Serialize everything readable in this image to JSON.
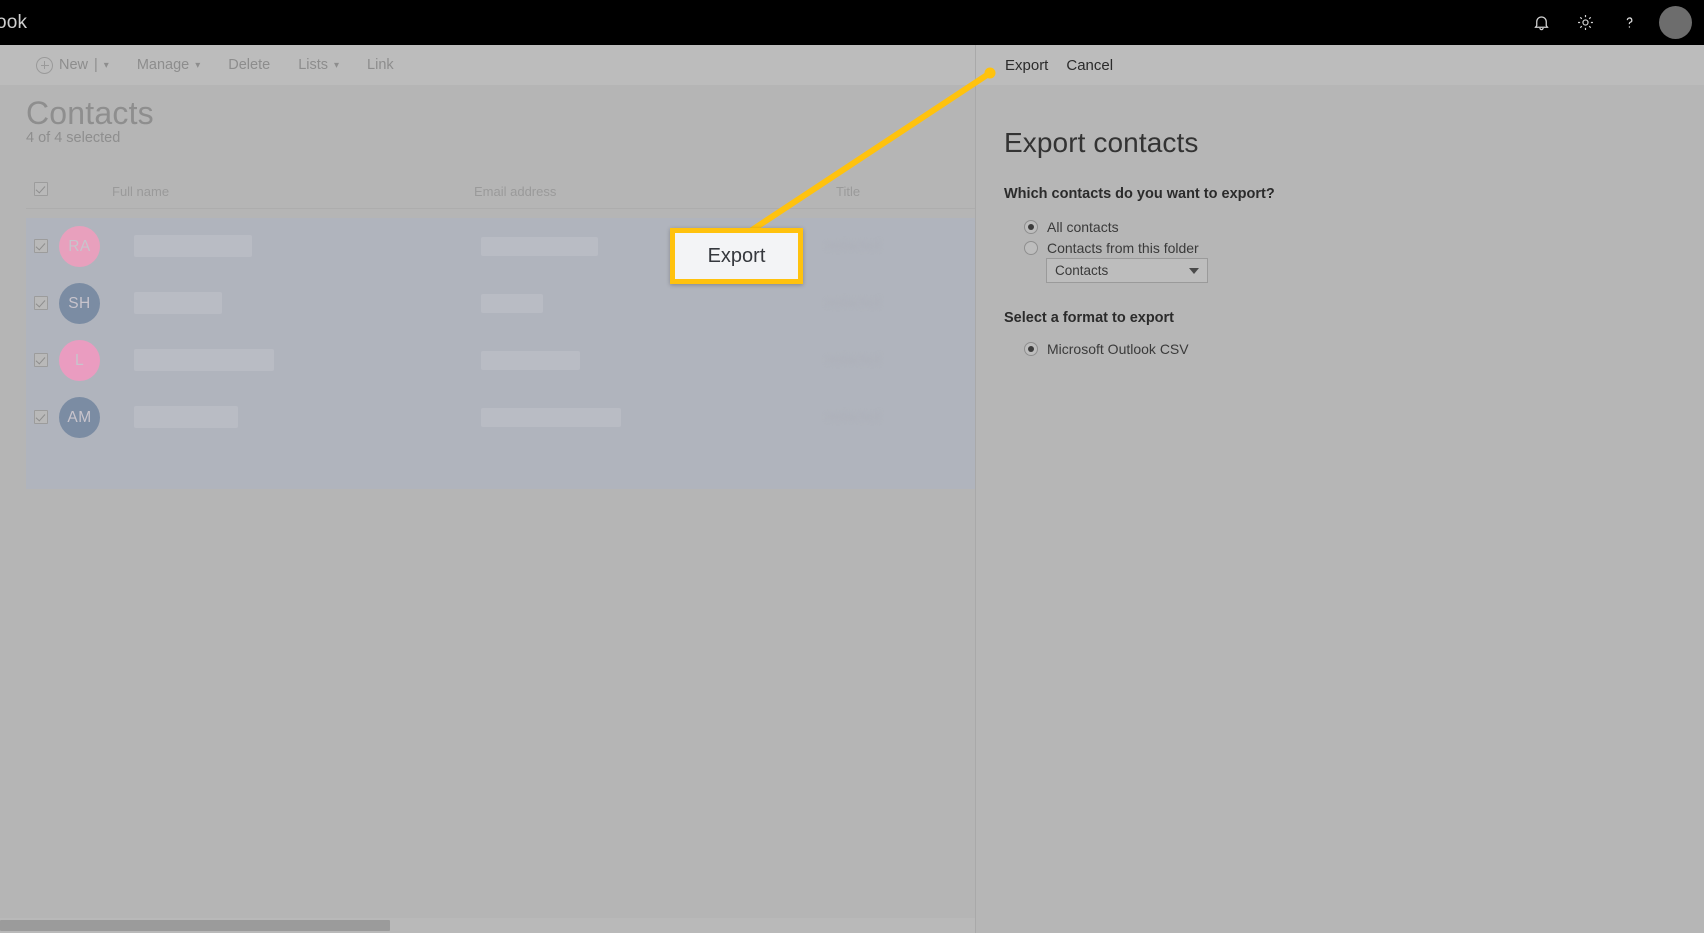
{
  "topbar": {
    "brand": "ook",
    "icons": [
      {
        "name": "notifications-icon",
        "glyph": "bell"
      },
      {
        "name": "settings-gear-icon",
        "glyph": "gear"
      },
      {
        "name": "help-icon",
        "glyph": "question"
      }
    ],
    "avatar_label": ""
  },
  "commandbar": {
    "items": [
      {
        "label": "New",
        "has_plus": true,
        "has_chevron": true,
        "separator": "|"
      },
      {
        "label": "Manage",
        "has_plus": false,
        "has_chevron": true
      },
      {
        "label": "Delete",
        "has_plus": false,
        "has_chevron": false
      },
      {
        "label": "Lists",
        "has_plus": false,
        "has_chevron": true
      },
      {
        "label": "Link",
        "has_plus": false,
        "has_chevron": false
      }
    ]
  },
  "page": {
    "title": "Contacts",
    "subtitle": "4 of 4 selected"
  },
  "table": {
    "columns": [
      "Full name",
      "Email address",
      "Title"
    ],
    "select_all_checked": true,
    "rows": [
      {
        "initials": "RA",
        "avatar_color": "#e8a0bd",
        "checked": true,
        "title_text": "redacted"
      },
      {
        "initials": "SH",
        "avatar_color": "#7b8ca3",
        "checked": true,
        "title_text": "redacted"
      },
      {
        "initials": "L",
        "avatar_color": "#ea9cc0",
        "checked": true,
        "title_text": "redacted"
      },
      {
        "initials": "AM",
        "avatar_color": "#7b8ca3",
        "checked": true,
        "title_text": "redacted"
      }
    ]
  },
  "export_panel": {
    "actions": {
      "export_label": "Export",
      "cancel_label": "Cancel"
    },
    "title": "Export contacts",
    "which_label": "Which contacts do you want to export?",
    "options": [
      {
        "label": "All contacts",
        "selected": true
      },
      {
        "label": "Contacts from this folder",
        "selected": false
      }
    ],
    "folder_dropdown": {
      "value": "Contacts"
    },
    "format_label": "Select a format to export",
    "formats": [
      {
        "label": "Microsoft Outlook CSV",
        "selected": true
      }
    ]
  },
  "callout": {
    "label": "Export",
    "border_color": "#ffc20e",
    "box_color": "#f3f4f6"
  },
  "colors": {
    "overlay_gray": "#b5b5b5",
    "topbar_black": "#000000",
    "highlight_yellow": "#ffc20e",
    "selected_row": "#b0b4bd"
  }
}
